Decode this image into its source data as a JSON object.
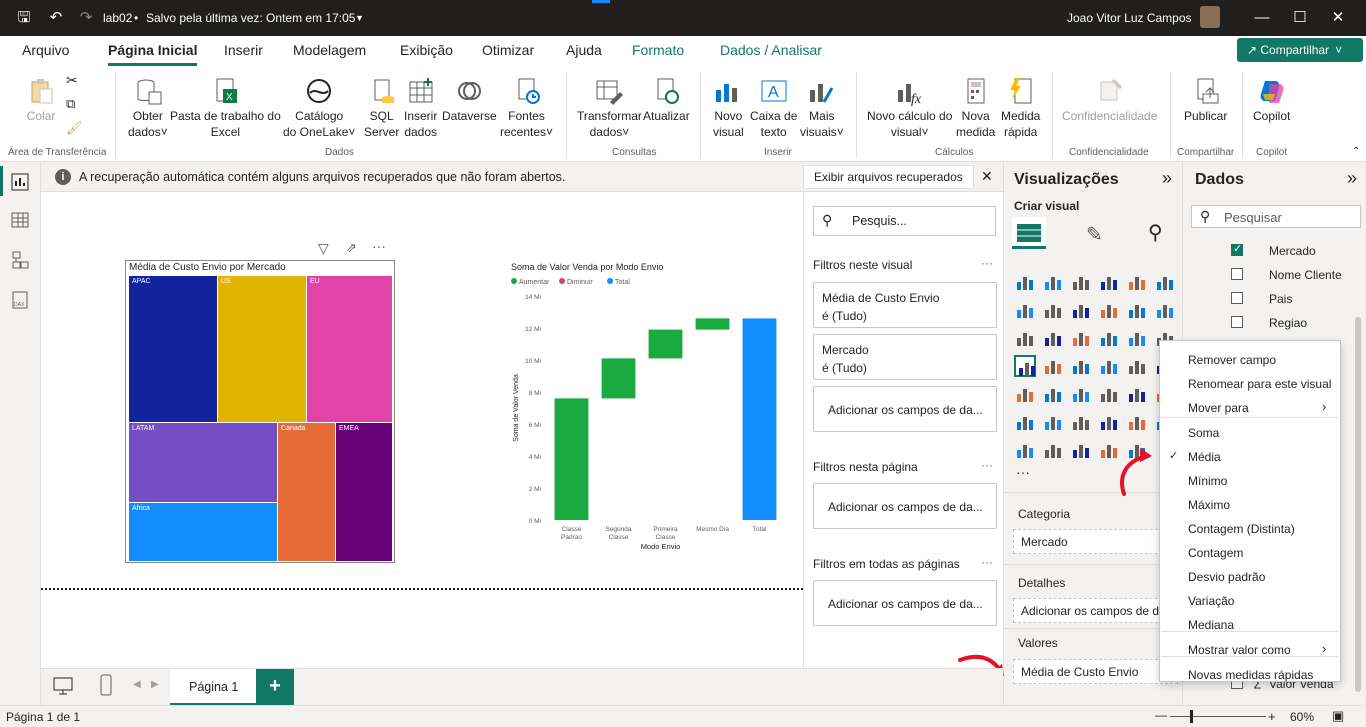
{
  "title_bar": {
    "file_name": "lab02",
    "save_status": "Salvo pela última vez: Ontem em 17:05",
    "user_name": "Joao Vitor Luz Campos"
  },
  "menu": {
    "tabs": [
      "Arquivo",
      "Página Inicial",
      "Inserir",
      "Modelagem",
      "Exibição",
      "Otimizar",
      "Ajuda",
      "Formato",
      "Dados / Analisar"
    ],
    "share": "Compartilhar"
  },
  "ribbon": {
    "colar": "Colar",
    "group_transfer": "Área de Transferência",
    "obter_dados": [
      "Obter",
      "dados"
    ],
    "pasta": [
      "Pasta de trabalho do",
      "Excel"
    ],
    "catalogo": [
      "Catálogo",
      "do OneLake"
    ],
    "sql": [
      "SQL",
      "Server"
    ],
    "inserir_dados": [
      "Inserir",
      "dados"
    ],
    "dataverse": "Dataverse",
    "fontes": [
      "Fontes",
      "recentes"
    ],
    "group_dados": "Dados",
    "transformar": [
      "Transformar",
      "dados"
    ],
    "atualizar": "Atualizar",
    "group_consultas": "Consultas",
    "novo_visual": [
      "Novo",
      "visual"
    ],
    "caixa_texto": [
      "Caixa de",
      "texto"
    ],
    "mais_visuais": [
      "Mais",
      "visuais"
    ],
    "group_inserir": "Inserir",
    "novo_calculo": [
      "Novo cálculo do",
      "visual"
    ],
    "nova_medida": [
      "Nova",
      "medida"
    ],
    "medida_rapida": [
      "Medida",
      "rápida"
    ],
    "group_calculos": "Cálculos",
    "confidencialidade": "Confidencialidade",
    "group_conf": "Confidencialidade",
    "publicar": "Publicar",
    "group_compartilhar": "Compartilhar",
    "copilot": "Copilot",
    "group_copilot": "Copilot"
  },
  "notification": {
    "text": "A recuperação automática contém alguns arquivos recuperados que não foram abertos.",
    "button": "Exibir arquivos recuperados"
  },
  "treemap": {
    "title": "Média de Custo Envio por Mercado",
    "labels": [
      "APAC",
      "US",
      "EU",
      "LATAM",
      "Canada",
      "EMEA",
      "Africa"
    ],
    "colors": [
      "#12239e",
      "#e0b400",
      "#e044a7",
      "#744ec2",
      "#e66c37",
      "#6b007b",
      "#118dff"
    ]
  },
  "chart_data": {
    "type": "bar",
    "title": "Soma de Valor Venda por Modo Envio",
    "xlabel": "Modo Envio",
    "ylabel": "Soma de Valor Venda",
    "legend": [
      "Aumentar",
      "Diminuir",
      "Total"
    ],
    "legend_colors": [
      "#1aab40",
      "#d64554",
      "#118dff"
    ],
    "categories": [
      "Classe Padrao",
      "Segunda Classe",
      "Primeira Classe",
      "Mesmo Dia",
      "Total"
    ],
    "category_lines": [
      [
        "Classe",
        "Padrao"
      ],
      [
        "Segunda",
        "Classe"
      ],
      [
        "Primeira",
        "Classe"
      ],
      [
        "Mesmo Dia"
      ],
      [
        "Total"
      ]
    ],
    "values": [
      7.6,
      2.5,
      1.8,
      0.7,
      12.6
    ],
    "ylim": [
      0,
      14
    ],
    "yticks": [
      "0 Mi",
      "2 Mi",
      "4 Mi",
      "6 Mi",
      "8 Mi",
      "10 Mi",
      "12 Mi",
      "14 Mi"
    ]
  },
  "filters": {
    "search": "Pesquis...",
    "visual_header": "Filtros neste visual",
    "card1": [
      "Média de Custo Envio",
      "é (Tudo)"
    ],
    "card2": [
      "Mercado",
      "é (Tudo)"
    ],
    "add": "Adicionar os campos de da...",
    "page_header": "Filtros nesta página",
    "all_header": "Filtros em todas as páginas"
  },
  "viz": {
    "header": "Visualizações",
    "subheader": "Criar visual",
    "categoria": "Categoria",
    "categoria_value": "Mercado",
    "detalhes": "Detalhes",
    "detalhes_value": "Adicionar os campos de da",
    "valores": "Valores",
    "valores_value": "Média de Custo Envio"
  },
  "data_pane": {
    "header": "Dados",
    "search": "Pesquisar",
    "fields": [
      "Mercado",
      "Nome Cliente",
      "Pais",
      "Regiao"
    ],
    "last_field": "Valor Venda"
  },
  "context_menu": {
    "items": [
      "Remover campo",
      "Renomear para este visual",
      "Mover para",
      "Soma",
      "Média",
      "Mínimo",
      "Máximo",
      "Contagem (Distinta)",
      "Contagem",
      "Desvio padrão",
      "Variação",
      "Mediana",
      "Mostrar valor como",
      "Novas medidas rápidas"
    ]
  },
  "pages": {
    "tab": "Página 1",
    "add": "+"
  },
  "status": {
    "page": "Página 1 de 1",
    "zoom": "60%"
  }
}
